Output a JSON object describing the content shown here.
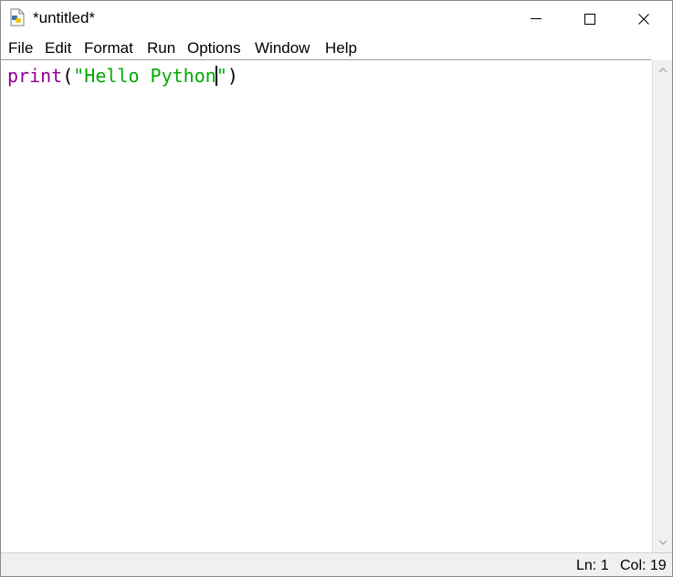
{
  "window": {
    "title": "*untitled*",
    "app_icon": "python-file-icon",
    "controls": {
      "minimize": "minimize-icon",
      "maximize": "maximize-icon",
      "close": "close-icon"
    }
  },
  "menu": {
    "items": [
      "File",
      "Edit",
      "Format",
      "Run",
      "Options",
      "Window",
      "Help"
    ]
  },
  "editor": {
    "code": {
      "builtin": "print",
      "open_paren": "(",
      "string_before_cursor": "\"Hello Python",
      "string_after_cursor": "\"",
      "close_paren": ")"
    },
    "colors": {
      "builtin": "#900090",
      "string": "#00aa00"
    }
  },
  "status": {
    "ln": "Ln: 1",
    "col": "Col: 19"
  }
}
